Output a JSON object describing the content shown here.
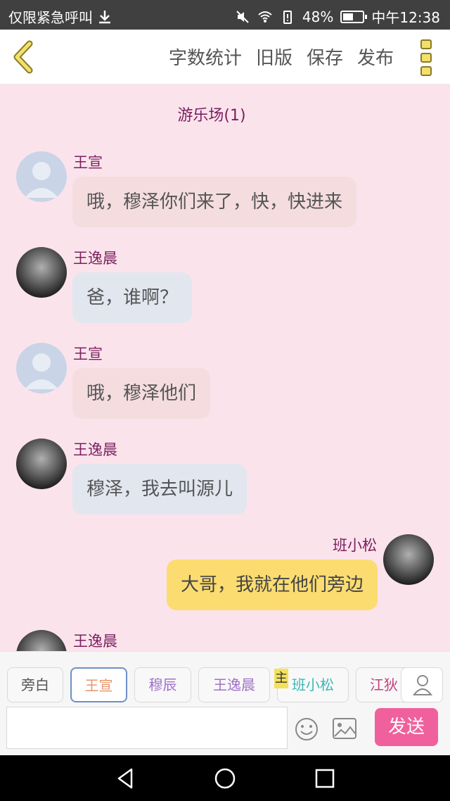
{
  "status_bar": {
    "left_text": "仅限紧急呼叫",
    "battery": "48%",
    "time": "中午12:38"
  },
  "app_bar": {
    "actions": [
      "字数统计",
      "旧版",
      "保存",
      "发布"
    ]
  },
  "chat": {
    "room_title": "游乐场(1)",
    "messages": [
      {
        "sender": "王宣",
        "text": "哦，穆泽你们来了，快，快进来",
        "side": "left",
        "avatar": "default"
      },
      {
        "sender": "王逸晨",
        "text": "爸，谁啊？",
        "side": "left",
        "avatar": "photo"
      },
      {
        "sender": "王宣",
        "text": "哦，穆泽他们",
        "side": "left",
        "avatar": "default"
      },
      {
        "sender": "王逸晨",
        "text": "穆泽，我去叫源儿",
        "side": "left",
        "avatar": "photo"
      },
      {
        "sender": "班小松",
        "text": "大哥，我就在他们旁边",
        "side": "right",
        "avatar": "photo"
      },
      {
        "sender": "王逸晨",
        "text": "",
        "side": "left",
        "avatar": "photo"
      }
    ]
  },
  "roles": {
    "items": [
      {
        "label": "旁白",
        "color": "#555555"
      },
      {
        "label": "王宣",
        "color": "#e6956a",
        "selected": true
      },
      {
        "label": "穆辰",
        "color": "#a070c8"
      },
      {
        "label": "王逸晨",
        "color": "#a070c8"
      },
      {
        "label": "班小松",
        "color": "#3bb8b4"
      },
      {
        "label": "江狄",
        "color": "#c2407e"
      }
    ],
    "host_tag": "主"
  },
  "composer": {
    "input_value": "",
    "send_label": "发送"
  }
}
